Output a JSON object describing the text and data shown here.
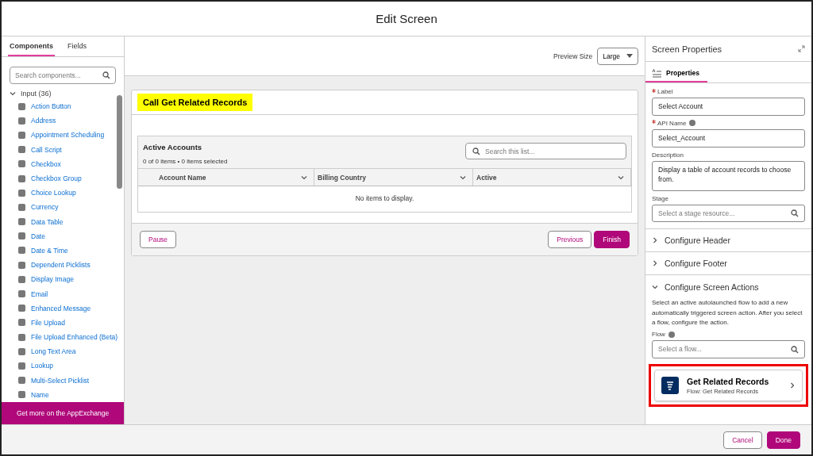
{
  "window": {
    "title": "Edit Screen"
  },
  "left_panel": {
    "tabs": [
      {
        "label": "Components",
        "selected": true
      },
      {
        "label": "Fields",
        "selected": false
      }
    ],
    "search": {
      "placeholder": "Search components..."
    },
    "group": {
      "label": "Input (36)",
      "expanded": true,
      "items": [
        "Action Button",
        "Address",
        "Appointment Scheduling",
        "Call Script",
        "Checkbox",
        "Checkbox Group",
        "Choice Lookup",
        "Currency",
        "Data Table",
        "Date",
        "Date & Time",
        "Dependent Picklists",
        "Display Image",
        "Email",
        "Enhanced Message",
        "File Upload",
        "File Upload Enhanced (Beta)",
        "Long Text Area",
        "Lookup",
        "Multi-Select Picklist",
        "Name"
      ]
    },
    "appexchange_button": "Get more on the AppExchange"
  },
  "canvas": {
    "preview_size_label": "Preview Size",
    "preview_size_value": "Large",
    "screen_title": "Call Get Related Records",
    "table": {
      "title": "Active Accounts",
      "summary": "0 of 0 items • 0 items selected",
      "search_placeholder": "Search this list...",
      "columns": [
        "Account Name",
        "Billing Country",
        "Active"
      ],
      "empty_message": "No items to display."
    },
    "buttons": [
      {
        "label": "Pause",
        "kind": "outline"
      },
      {
        "label": "Previous",
        "kind": "outline"
      },
      {
        "label": "Finish",
        "kind": "brand"
      }
    ]
  },
  "properties": {
    "title": "Screen Properties",
    "tab": "Properties",
    "fields": [
      {
        "label": "Label",
        "required": true,
        "info": false,
        "value": "Select Account",
        "kind": "input"
      },
      {
        "label": "API Name",
        "required": true,
        "info": true,
        "value": "Select_Account",
        "kind": "input"
      },
      {
        "label": "Description",
        "required": false,
        "info": false,
        "value": "Display a table of account records to choose from.",
        "kind": "textarea"
      },
      {
        "label": "Stage",
        "required": false,
        "info": false,
        "placeholder": "Select a stage resource...",
        "kind": "search"
      }
    ],
    "sections": [
      {
        "label": "Configure Header",
        "expanded": false
      },
      {
        "label": "Configure Footer",
        "expanded": false
      },
      {
        "label": "Configure Screen Actions",
        "expanded": true
      }
    ],
    "actions_help": "Select an active autolaunched flow to add a new automatically triggered screen action. After you select a flow, configure the action.",
    "flow_field": {
      "label": "Flow",
      "placeholder": "Select a flow..."
    },
    "action_card": {
      "title": "Get Related Records",
      "subtitle": "Flow: Get Related Records"
    }
  },
  "footer": {
    "buttons": [
      {
        "label": "Cancel",
        "kind": "outline"
      },
      {
        "label": "Done",
        "kind": "brand"
      }
    ]
  }
}
